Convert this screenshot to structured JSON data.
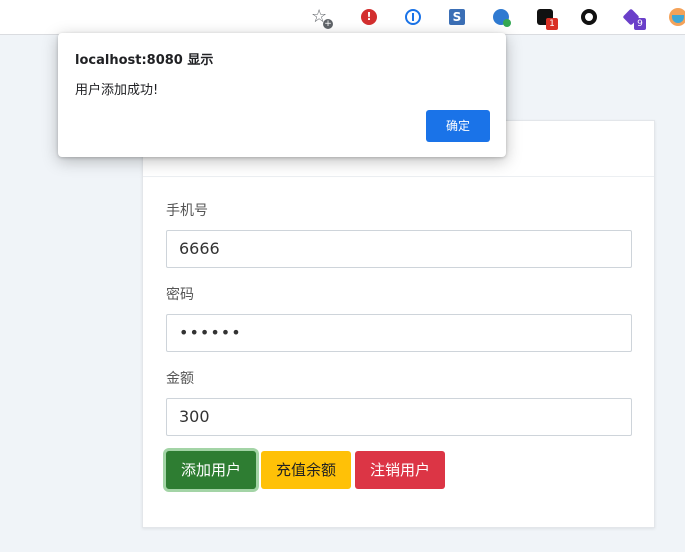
{
  "dialog": {
    "title": "localhost:8080 显示",
    "message": "用户添加成功!",
    "ok_label": "确定"
  },
  "form": {
    "phone": {
      "label": "手机号",
      "value": "6666"
    },
    "password": {
      "label": "密码",
      "value": "••••••"
    },
    "amount": {
      "label": "金额",
      "value": "300"
    }
  },
  "buttons": {
    "add_user": "添加用户",
    "recharge": "充值余额",
    "cancel_user": "注销用户"
  },
  "extensions": {
    "badge_dark": "1",
    "badge_purple": "9"
  },
  "icons": [
    "bookmark-star-icon",
    "adblock-icon",
    "password-manager-icon",
    "s-extension-icon",
    "globe-extension-icon",
    "dark-extension-icon",
    "ring-extension-icon",
    "purple-extension-icon",
    "profile-avatar-icon"
  ]
}
